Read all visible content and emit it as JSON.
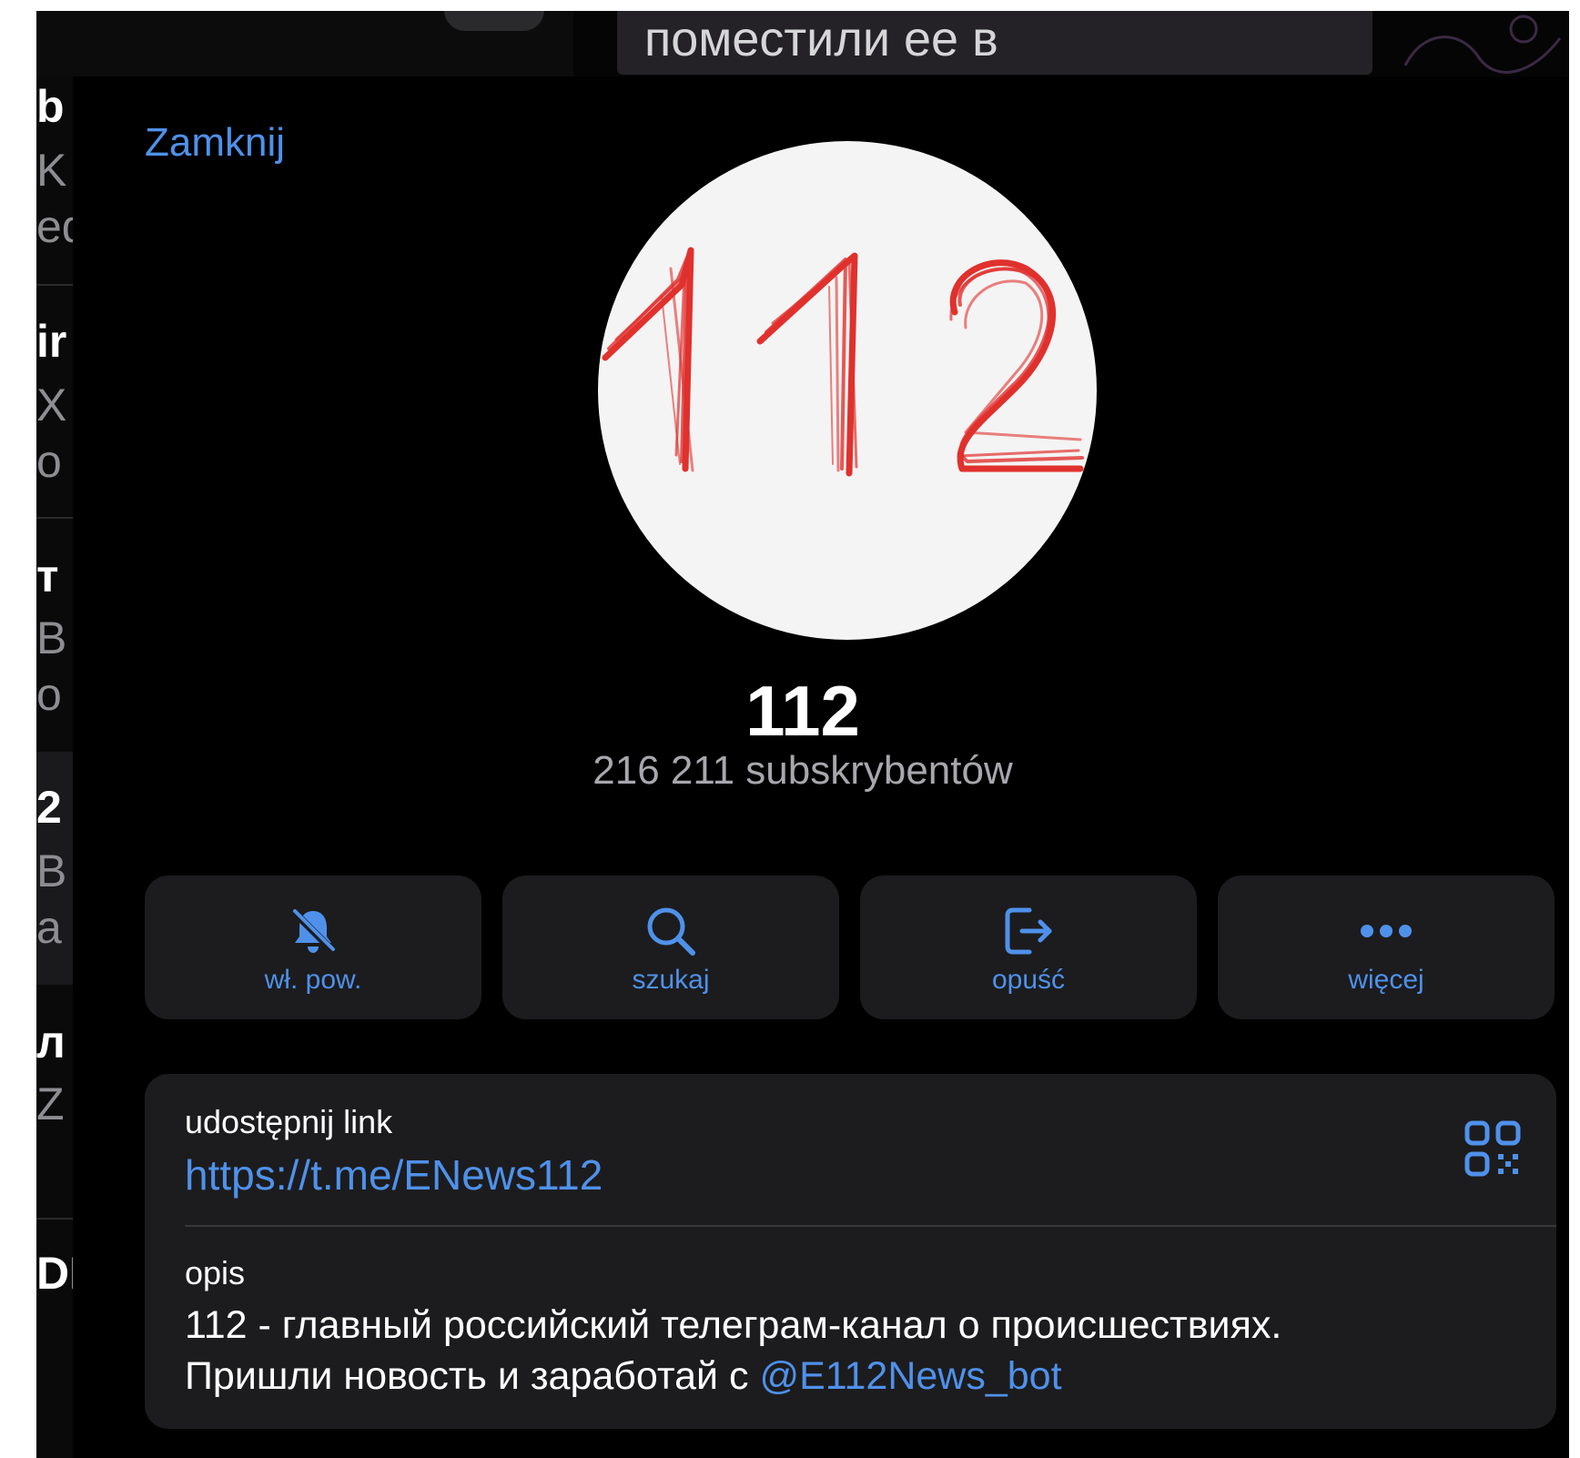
{
  "background": {
    "chat_fragments": [
      "b",
      "K",
      "ed",
      "ir",
      "X",
      "o",
      "т",
      "B",
      "o",
      "2",
      "B",
      "a",
      "л",
      "Z",
      "DE"
    ],
    "bubble_text": "поместили ее в"
  },
  "sheet": {
    "close_label": "Zamknij",
    "avatar_text": "112",
    "channel_name": "112",
    "subscribers": "216 211 subskrybentów"
  },
  "actions": [
    {
      "label": "wł. pow.",
      "icon": "bell-slash-icon"
    },
    {
      "label": "szukaj",
      "icon": "search-icon"
    },
    {
      "label": "opuść",
      "icon": "leave-icon"
    },
    {
      "label": "więcej",
      "icon": "more-icon"
    }
  ],
  "info": {
    "link_caption": "udostępnij link",
    "link_url": "https://t.me/ENews112",
    "qr_icon": "qr-code-icon",
    "description_caption": "opis",
    "description_line1": "112 - главный российский телеграм-канал о происшествиях.",
    "description_line2": "Пришли новость и заработай с ",
    "description_bot": "@E112News_bot"
  },
  "colors": {
    "accent": "#4f91ea",
    "card": "#1c1c1e",
    "background": "#000000",
    "avatar_stroke": "#e0312d"
  }
}
